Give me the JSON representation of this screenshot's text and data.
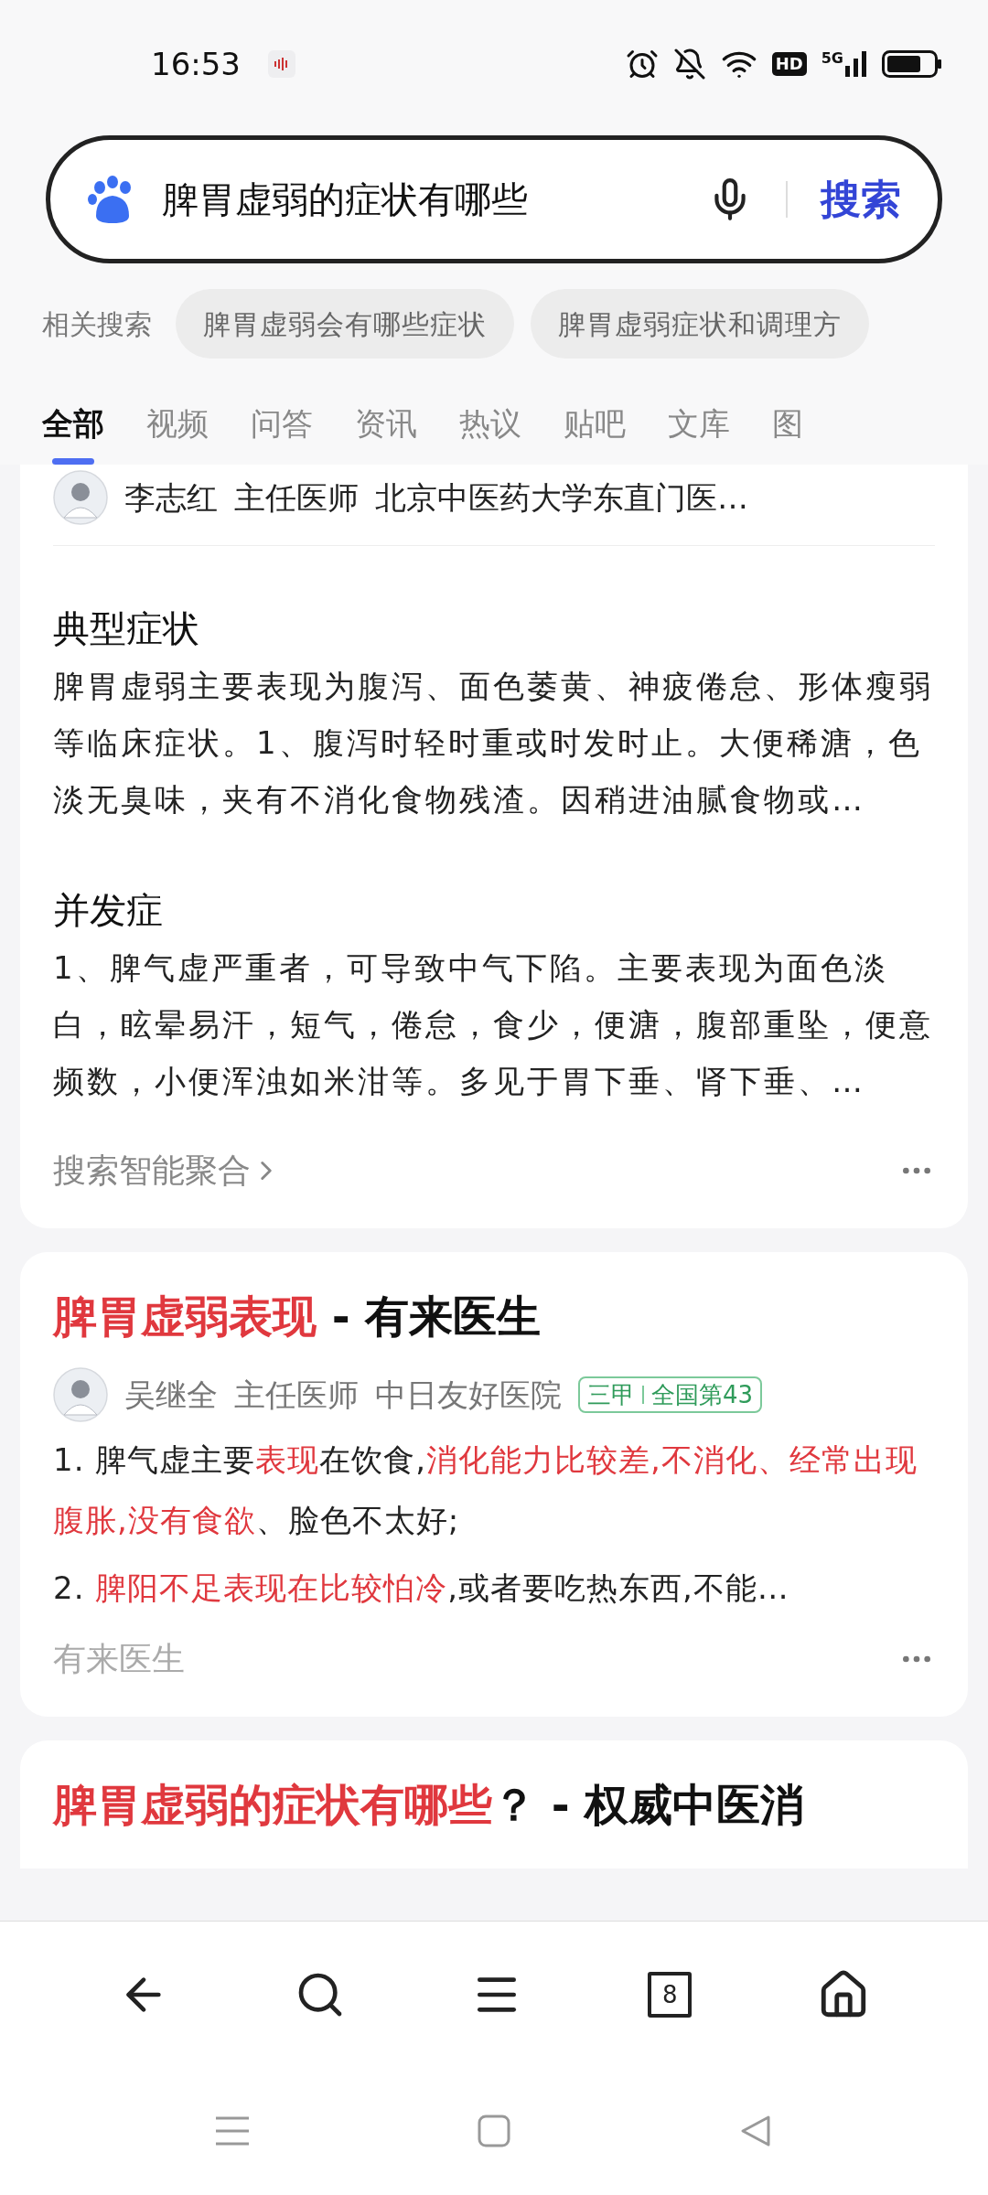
{
  "status_bar": {
    "time": "16:53",
    "badges": [
      "HD",
      "5G"
    ]
  },
  "search": {
    "value": "脾胃虚弱的症状有哪些",
    "button": "搜索"
  },
  "related": {
    "label": "相关搜索",
    "chips": [
      "脾胃虚弱会有哪些症状",
      "脾胃虚弱症状和调理方"
    ]
  },
  "tabs": [
    {
      "label": "全部",
      "selected": true
    },
    {
      "label": "视频",
      "selected": false
    },
    {
      "label": "问答",
      "selected": false
    },
    {
      "label": "资讯",
      "selected": false
    },
    {
      "label": "热议",
      "selected": false
    },
    {
      "label": "贴吧",
      "selected": false
    },
    {
      "label": "文库",
      "selected": false
    },
    {
      "label": "图",
      "selected": false
    }
  ],
  "cards": [
    {
      "kind": "aggregate",
      "author": {
        "name": "李志红",
        "title": "主任医师",
        "hospital": "北京中医药大学东直门医…"
      },
      "sections": [
        {
          "heading": "典型症状",
          "text": "脾胃虚弱主要表现为腹泻、面色萎黄、神疲倦怠、形体瘦弱等临床症状。1、腹泻时轻时重或时发时止。大便稀溏，色淡无臭味，夹有不消化食物残渣。因稍进油腻食物或…"
        },
        {
          "heading": "并发症",
          "text": "1、脾气虚严重者，可导致中气下陷。主要表现为面色淡白，眩晕易汗，短气，倦怠，食少，便溏，腹部重坠，便意频数，小便浑浊如米泔等。多见于胃下垂、肾下垂、…"
        }
      ],
      "footer": "搜索智能聚合"
    },
    {
      "kind": "result",
      "title": [
        {
          "text": "脾胃虚弱表现",
          "highlight": true
        },
        {
          "text": " - 有来医生",
          "highlight": false
        }
      ],
      "author": {
        "name": "吴继全",
        "title": "主任医师",
        "hospital": "中日友好医院",
        "badge": [
          "三甲",
          "全国第43"
        ]
      },
      "lines": [
        [
          {
            "text": "1. 脾气虚主要",
            "highlight": false
          },
          {
            "text": "表现",
            "highlight": true
          },
          {
            "text": "在饮食,",
            "highlight": false
          },
          {
            "text": "消化能力比较差,不消化、经常出现腹胀,没有食欲",
            "highlight": true
          },
          {
            "text": "、脸色不太好;",
            "highlight": false
          }
        ],
        [
          {
            "text": "2. ",
            "highlight": false
          },
          {
            "text": "脾阳不足表现在比较怕冷",
            "highlight": true
          },
          {
            "text": ",或者要吃热东西,不能…",
            "highlight": false
          }
        ]
      ],
      "footer": "有来医生"
    },
    {
      "kind": "partial",
      "title": [
        {
          "text": "脾胃虚弱的症状有哪些",
          "highlight": true
        },
        {
          "text": "？ - 权威中医消",
          "highlight": false
        }
      ]
    }
  ],
  "bottom_nav": {
    "tab_count": "8"
  }
}
